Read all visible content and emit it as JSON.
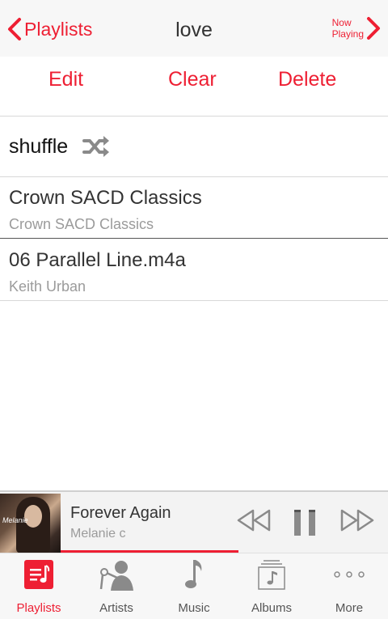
{
  "nav": {
    "back_label": "Playlists",
    "title": "love",
    "now_playing_line1": "Now",
    "now_playing_line2": "Playing"
  },
  "actions": {
    "edit": "Edit",
    "clear": "Clear",
    "delete": "Delete"
  },
  "shuffle": {
    "label": "shuffle",
    "icon": "shuffle-icon"
  },
  "tracks": [
    {
      "title": "Crown SACD Classics",
      "subtitle": "Crown SACD Classics"
    },
    {
      "title": "06 Parallel Line.m4a",
      "subtitle": "Keith Urban"
    }
  ],
  "player": {
    "title": "Forever Again",
    "artist": "Melanie c",
    "art_text": "Melanie",
    "progress": 0.5
  },
  "tabs": [
    {
      "label": "Playlists",
      "icon": "playlists-icon",
      "active": true
    },
    {
      "label": "Artists",
      "icon": "artists-icon",
      "active": false
    },
    {
      "label": "Music",
      "icon": "music-note-icon",
      "active": false
    },
    {
      "label": "Albums",
      "icon": "albums-icon",
      "active": false
    },
    {
      "label": "More",
      "icon": "more-icon",
      "active": false
    }
  ],
  "colors": {
    "accent": "#ee1f33",
    "text": "#333333",
    "secondary_text": "#9b9b9b",
    "bar_background": "#f7f7f7"
  }
}
